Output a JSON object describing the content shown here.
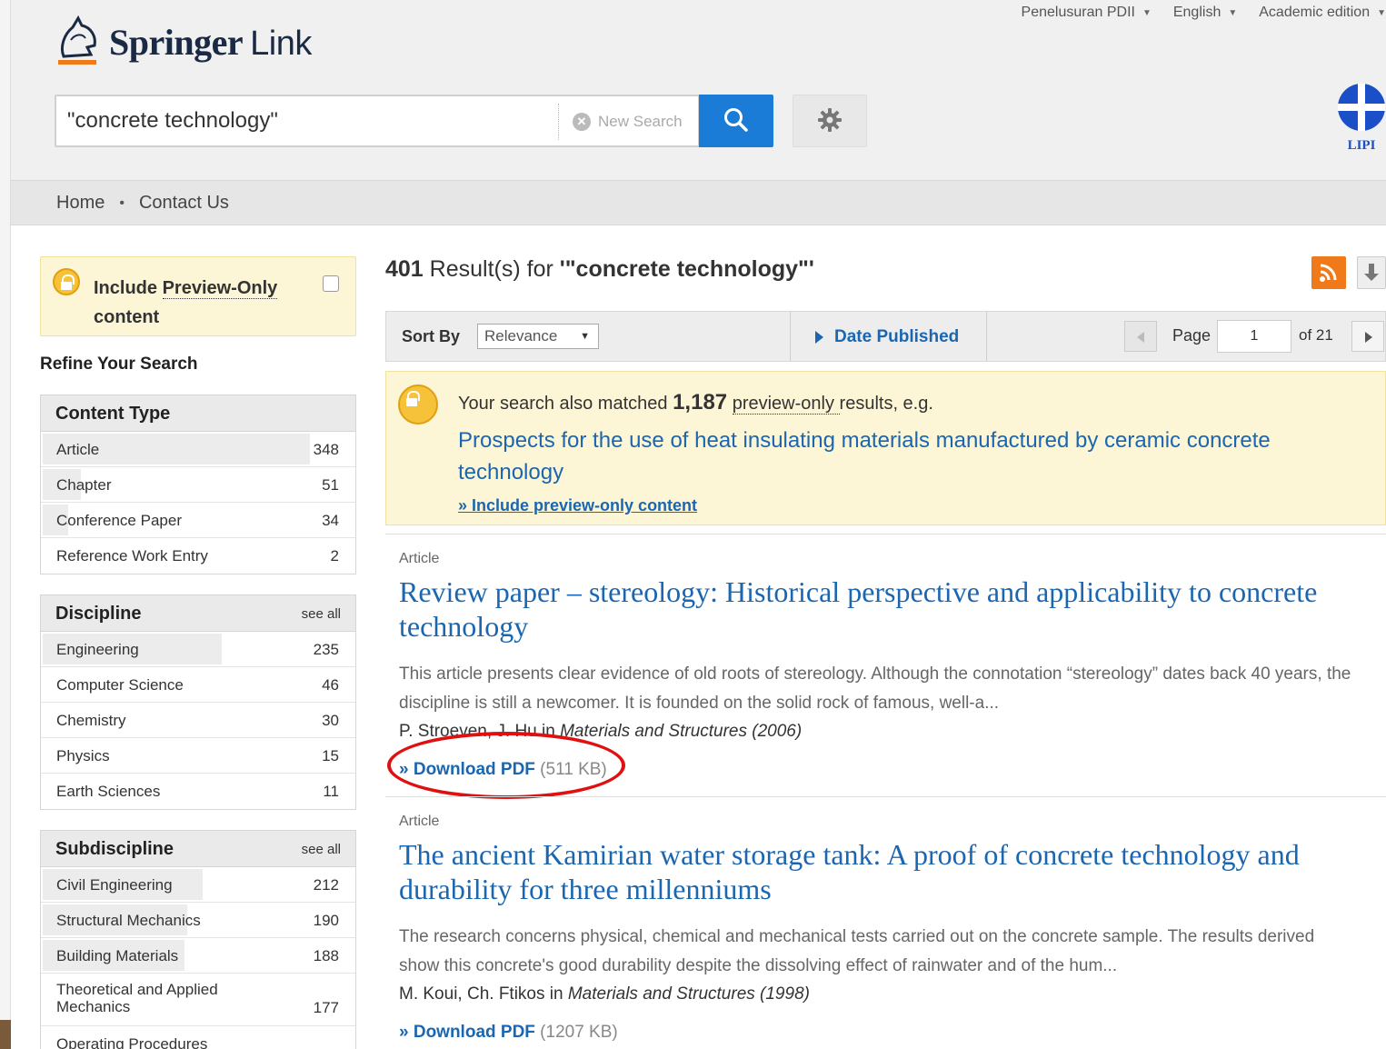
{
  "header": {
    "logo_main": "Springer",
    "logo_sub": "Link",
    "top_links": [
      "Penelusuran PDII",
      "English",
      "Academic edition"
    ],
    "search_value": "\"concrete technology\"",
    "new_search": "New Search",
    "partner_logo": "LIPI"
  },
  "nav": {
    "home": "Home",
    "separator": "•",
    "contact": "Contact Us"
  },
  "sidebar": {
    "preview_label_prefix": "Include ",
    "preview_label_u": "Preview-Only",
    "preview_label_suffix": "content",
    "refine_title": "Refine Your Search",
    "content_type": {
      "title": "Content Type",
      "items": [
        {
          "name": "Article",
          "count": "348",
          "share": 0.85
        },
        {
          "name": "Chapter",
          "count": "51",
          "share": 0.12
        },
        {
          "name": "Conference Paper",
          "count": "34",
          "share": 0.08
        },
        {
          "name": "Reference Work Entry",
          "count": "2",
          "share": 0.0
        }
      ]
    },
    "discipline": {
      "title": "Discipline",
      "see_all": "see all",
      "items": [
        {
          "name": "Engineering",
          "count": "235",
          "share": 0.57
        },
        {
          "name": "Computer Science",
          "count": "46",
          "share": 0.0
        },
        {
          "name": "Chemistry",
          "count": "30",
          "share": 0.0
        },
        {
          "name": "Physics",
          "count": "15",
          "share": 0.0
        },
        {
          "name": "Earth Sciences",
          "count": "11",
          "share": 0.0
        }
      ]
    },
    "subdiscipline": {
      "title": "Subdiscipline",
      "see_all": "see all",
      "items": [
        {
          "name": "Civil Engineering",
          "count": "212",
          "share": 0.51
        },
        {
          "name": "Structural Mechanics",
          "count": "190",
          "share": 0.46
        },
        {
          "name": "Building Materials",
          "count": "188",
          "share": 0.45
        },
        {
          "name": "Theoretical and Applied Mechanics",
          "count": "177",
          "share": 0.0
        },
        {
          "name": "Operating Procedures",
          "count": "",
          "share": 0.0
        }
      ]
    }
  },
  "results": {
    "count": "401",
    "label": " Result(s) for ",
    "query": "'\"concrete technology\"'",
    "sort_by": "Sort By",
    "sort_value": "Relevance",
    "date_published": "Date Published",
    "page_label": "Page",
    "page_value": "1",
    "page_of": "of 21"
  },
  "preview_match": {
    "text_prefix": "Your search also matched ",
    "count": "1,187",
    "text_u": "preview-only ",
    "text_suffix": "results, e.g.",
    "link": "Prospects for the use of heat insulating materials manufactured by ceramic concrete technology",
    "include": "» Include preview-only content"
  },
  "items": [
    {
      "type": "Article",
      "title": "Review paper – stereology: Historical perspective and applicability to concrete technology",
      "snippet": "This article presents clear evidence of old roots of stereology. Although the connotation “stereology” dates back 40 years, the discipline is still a newcomer. It is founded on the solid rock of famous, well-a...",
      "authors": "P. Stroeven, J. Hu in ",
      "journal": "Materials and Structures (2006)",
      "download": "» Download PDF",
      "size": " (511 KB)"
    },
    {
      "type": "Article",
      "title": "The ancient Kamirian water storage tank: A proof of concrete technology and durability for three millenniums",
      "snippet": "The research concerns physical, chemical and mechanical tests carried out on the concrete sample. The results derived show this concrete's good durability despite the dissolving effect of rainwater and of the hum...",
      "authors": "M. Koui, Ch. Ftikos in ",
      "journal": "Materials and Structures (1998)",
      "download": "» Download PDF",
      "size": " (1207 KB)"
    }
  ],
  "colors": {
    "link": "#1a66b0",
    "search_button": "#1a7cd6",
    "rss": "#f07a1a",
    "highlight": "#e01010",
    "preview_bg": "#fdf6d6"
  }
}
